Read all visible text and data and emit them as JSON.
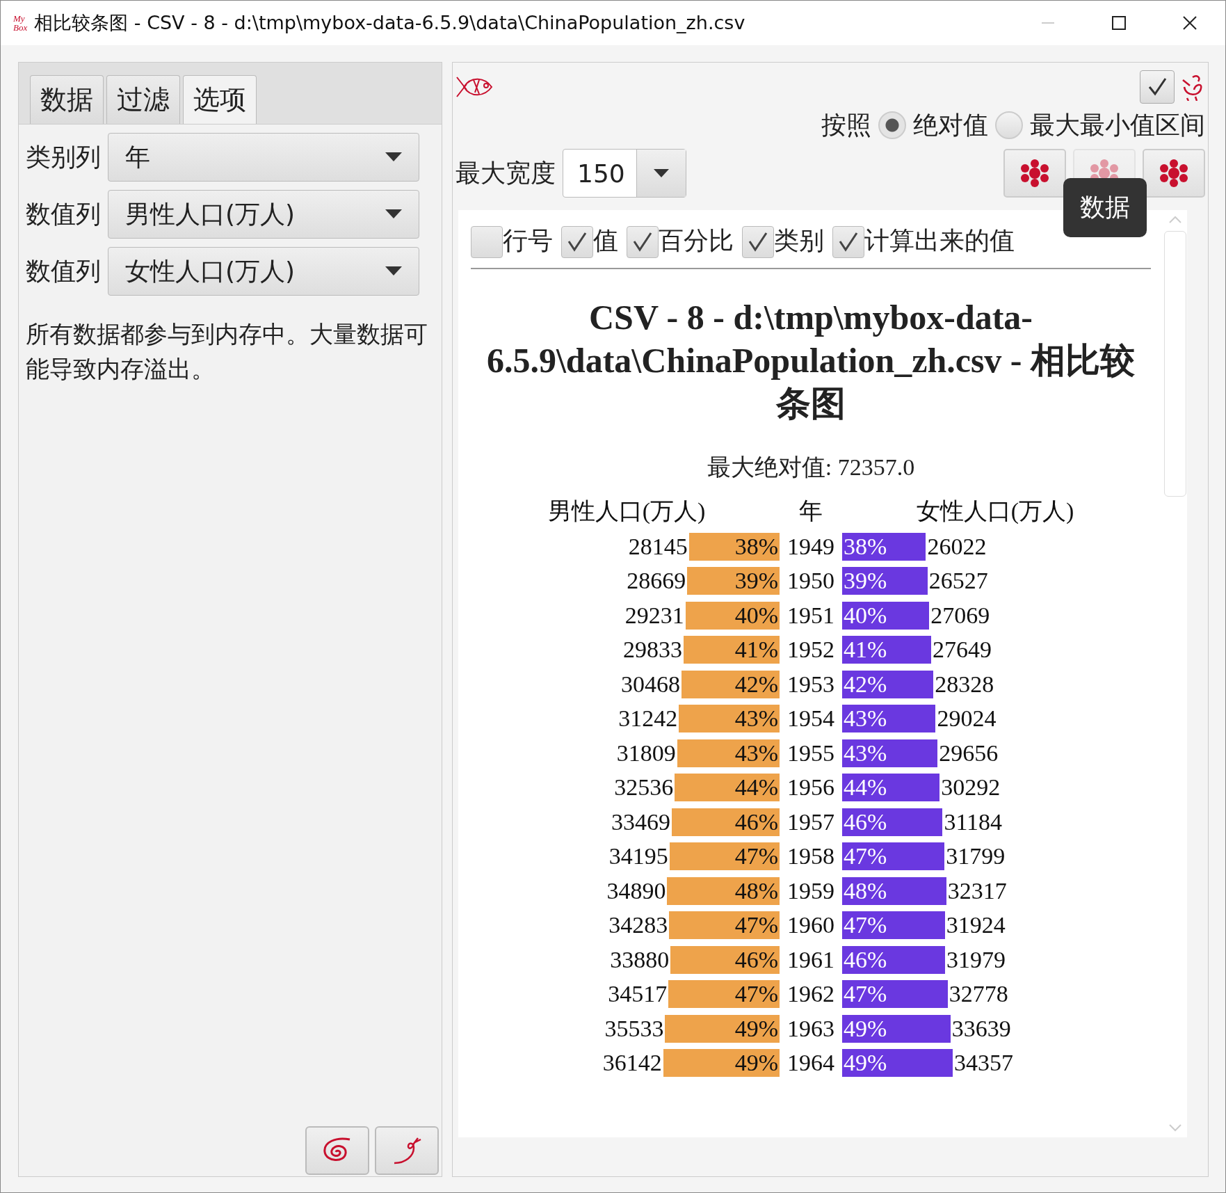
{
  "window": {
    "logo_lines": [
      "My",
      "Box"
    ],
    "title": "相比较条图 - CSV - 8 - d:\\tmp\\mybox-data-6.5.9\\data\\ChinaPopulation_zh.csv"
  },
  "left_panel": {
    "tabs": [
      {
        "label": "数据",
        "selected": false
      },
      {
        "label": "过滤",
        "selected": false
      },
      {
        "label": "选项",
        "selected": true
      }
    ],
    "fields": [
      {
        "label": "类别列",
        "value": "年"
      },
      {
        "label": "数值列",
        "value": "男性人口(万人)"
      },
      {
        "label": "数值列",
        "value": "女性人口(万人)"
      }
    ],
    "note": "所有数据都参与到内存中。大量数据可能导致内存溢出。"
  },
  "right_panel": {
    "scale": {
      "label": "按照",
      "options": [
        {
          "label": "绝对值",
          "selected": true
        },
        {
          "label": "最大最小值区间",
          "selected": false
        }
      ]
    },
    "max_width": {
      "label": "最大宽度",
      "value": "150"
    },
    "style_buttons": [
      {
        "disabled": false
      },
      {
        "disabled": true
      },
      {
        "disabled": false
      }
    ],
    "tooltip": "数据",
    "options": [
      {
        "label": "行号",
        "checked": false
      },
      {
        "label": "值",
        "checked": true
      },
      {
        "label": "百分比",
        "checked": true
      },
      {
        "label": "类别",
        "checked": true
      },
      {
        "label": "计算出来的值",
        "checked": true
      }
    ],
    "report": {
      "title": "CSV - 8 - d:\\tmp\\mybox-data-6.5.9\\data\\ChinaPopulation_zh.csv - 相比较条图",
      "max_text": "最大绝对值: 72357.0",
      "headers": [
        "男性人口(万人)",
        "年",
        "女性人口(万人)"
      ],
      "rows": [
        {
          "category": "1949",
          "left": {
            "value": "28145",
            "percent": "38%"
          },
          "right": {
            "value": "26022",
            "percent": "38%"
          }
        },
        {
          "category": "1950",
          "left": {
            "value": "28669",
            "percent": "39%"
          },
          "right": {
            "value": "26527",
            "percent": "39%"
          }
        },
        {
          "category": "1951",
          "left": {
            "value": "29231",
            "percent": "40%"
          },
          "right": {
            "value": "27069",
            "percent": "40%"
          }
        },
        {
          "category": "1952",
          "left": {
            "value": "29833",
            "percent": "41%"
          },
          "right": {
            "value": "27649",
            "percent": "41%"
          }
        },
        {
          "category": "1953",
          "left": {
            "value": "30468",
            "percent": "42%"
          },
          "right": {
            "value": "28328",
            "percent": "42%"
          }
        },
        {
          "category": "1954",
          "left": {
            "value": "31242",
            "percent": "43%"
          },
          "right": {
            "value": "29024",
            "percent": "43%"
          }
        },
        {
          "category": "1955",
          "left": {
            "value": "31809",
            "percent": "43%"
          },
          "right": {
            "value": "29656",
            "percent": "43%"
          }
        },
        {
          "category": "1956",
          "left": {
            "value": "32536",
            "percent": "44%"
          },
          "right": {
            "value": "30292",
            "percent": "44%"
          }
        },
        {
          "category": "1957",
          "left": {
            "value": "33469",
            "percent": "46%"
          },
          "right": {
            "value": "31184",
            "percent": "46%"
          }
        },
        {
          "category": "1958",
          "left": {
            "value": "34195",
            "percent": "47%"
          },
          "right": {
            "value": "31799",
            "percent": "47%"
          }
        },
        {
          "category": "1959",
          "left": {
            "value": "34890",
            "percent": "48%"
          },
          "right": {
            "value": "32317",
            "percent": "48%"
          }
        },
        {
          "category": "1960",
          "left": {
            "value": "34283",
            "percent": "47%"
          },
          "right": {
            "value": "31924",
            "percent": "47%"
          }
        },
        {
          "category": "1961",
          "left": {
            "value": "33880",
            "percent": "46%"
          },
          "right": {
            "value": "31979",
            "percent": "46%"
          }
        },
        {
          "category": "1962",
          "left": {
            "value": "34517",
            "percent": "47%"
          },
          "right": {
            "value": "32778",
            "percent": "47%"
          }
        },
        {
          "category": "1963",
          "left": {
            "value": "35533",
            "percent": "49%"
          },
          "right": {
            "value": "33639",
            "percent": "49%"
          }
        },
        {
          "category": "1964",
          "left": {
            "value": "36142",
            "percent": "49%"
          },
          "right": {
            "value": "34357",
            "percent": "49%"
          }
        }
      ]
    }
  }
}
